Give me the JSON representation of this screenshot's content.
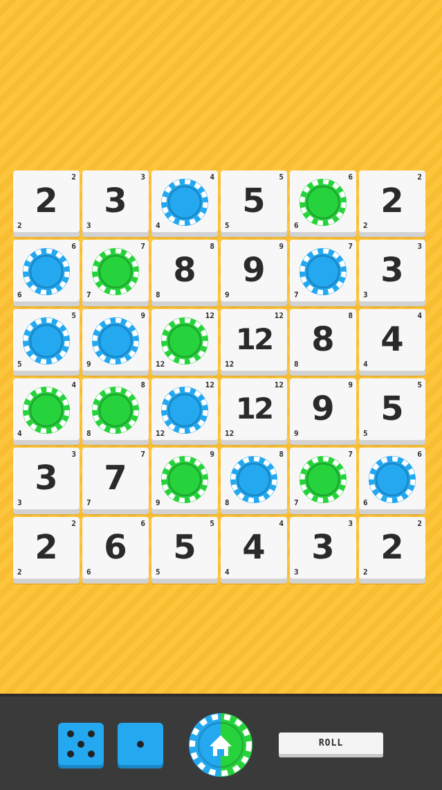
{
  "board": {
    "rows": [
      [
        {
          "type": "number",
          "value": "2",
          "corner": "2"
        },
        {
          "type": "number",
          "value": "3",
          "corner": "3"
        },
        {
          "type": "chip",
          "color": "blue",
          "corner": "4"
        },
        {
          "type": "number",
          "value": "5",
          "corner": "5"
        },
        {
          "type": "chip",
          "color": "green",
          "corner": "6"
        },
        {
          "type": "number",
          "value": "2",
          "corner": "2"
        }
      ],
      [
        {
          "type": "chip",
          "color": "blue",
          "corner": "6"
        },
        {
          "type": "chip",
          "color": "green",
          "corner": "7"
        },
        {
          "type": "number",
          "value": "8",
          "corner": "8"
        },
        {
          "type": "number",
          "value": "9",
          "corner": "9"
        },
        {
          "type": "chip",
          "color": "blue",
          "corner": "7"
        },
        {
          "type": "number",
          "value": "3",
          "corner": "3"
        }
      ],
      [
        {
          "type": "chip",
          "color": "blue",
          "corner": "5"
        },
        {
          "type": "chip",
          "color": "blue",
          "corner": "9"
        },
        {
          "type": "chip",
          "color": "green",
          "corner": "12"
        },
        {
          "type": "number",
          "value": "12",
          "corner": "12"
        },
        {
          "type": "number",
          "value": "8",
          "corner": "8"
        },
        {
          "type": "number",
          "value": "4",
          "corner": "4"
        }
      ],
      [
        {
          "type": "chip",
          "color": "green",
          "corner": "4"
        },
        {
          "type": "chip",
          "color": "green",
          "corner": "8"
        },
        {
          "type": "chip",
          "color": "blue",
          "corner": "12"
        },
        {
          "type": "number",
          "value": "12",
          "corner": "12"
        },
        {
          "type": "number",
          "value": "9",
          "corner": "9"
        },
        {
          "type": "number",
          "value": "5",
          "corner": "5"
        }
      ],
      [
        {
          "type": "number",
          "value": "3",
          "corner": "3"
        },
        {
          "type": "number",
          "value": "7",
          "corner": "7"
        },
        {
          "type": "chip",
          "color": "green",
          "corner": "9"
        },
        {
          "type": "chip",
          "color": "blue",
          "corner": "8"
        },
        {
          "type": "chip",
          "color": "green",
          "corner": "7"
        },
        {
          "type": "chip",
          "color": "blue",
          "corner": "6"
        }
      ],
      [
        {
          "type": "number",
          "value": "2",
          "corner": "2"
        },
        {
          "type": "number",
          "value": "6",
          "corner": "6"
        },
        {
          "type": "number",
          "value": "5",
          "corner": "5"
        },
        {
          "type": "number",
          "value": "4",
          "corner": "4"
        },
        {
          "type": "number",
          "value": "3",
          "corner": "3"
        },
        {
          "type": "number",
          "value": "2",
          "corner": "2"
        }
      ]
    ]
  },
  "controls": {
    "dice": [
      5,
      1
    ],
    "home_icon": "home-icon",
    "roll_label": "ROLL"
  },
  "colors": {
    "background": "#fcc53b",
    "chip_blue": "#24a8f0",
    "chip_green": "#27d33c",
    "bar": "#3a3a3a"
  }
}
